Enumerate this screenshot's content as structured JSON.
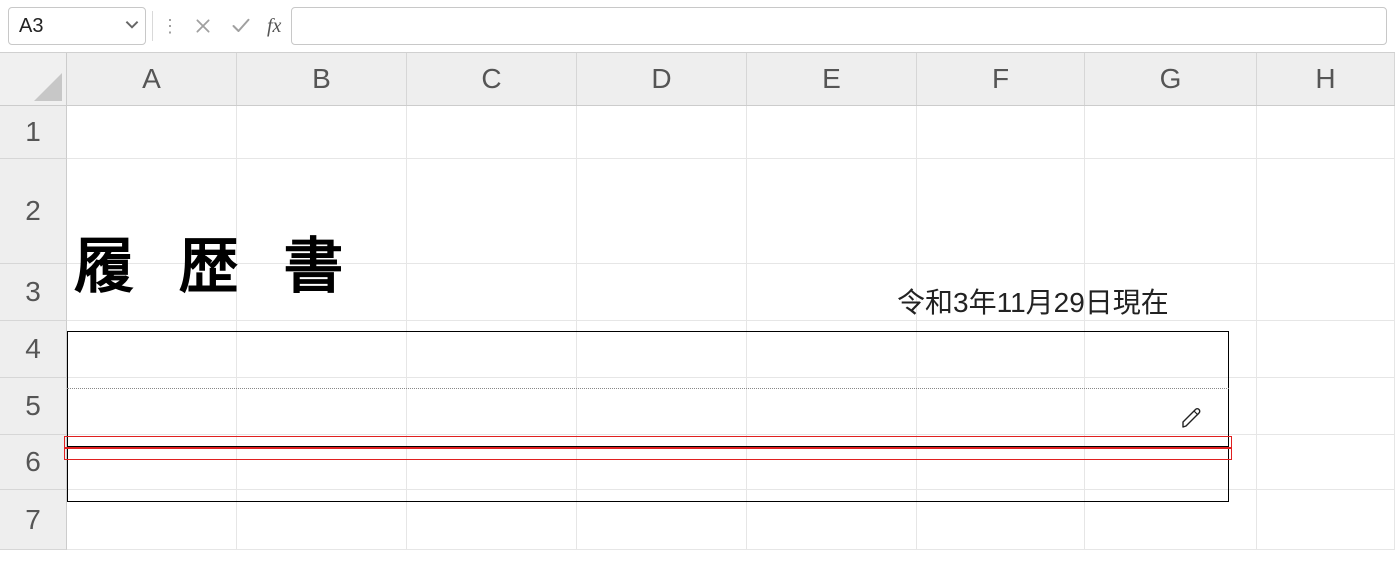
{
  "formula_bar": {
    "name_box_value": "A3",
    "cancel_label": "✕",
    "accept_label": "✓",
    "fx_label": "fx",
    "formula_value": ""
  },
  "columns": {
    "A": "A",
    "B": "B",
    "C": "C",
    "D": "D",
    "E": "E",
    "F": "F",
    "G": "G",
    "H": "H"
  },
  "rows": {
    "1": "1",
    "2": "2",
    "3": "3",
    "4": "4",
    "5": "5",
    "6": "6",
    "7": "7"
  },
  "sheet": {
    "title": "履 歴 書",
    "date_stamp": "令和3年11月29日現在"
  }
}
